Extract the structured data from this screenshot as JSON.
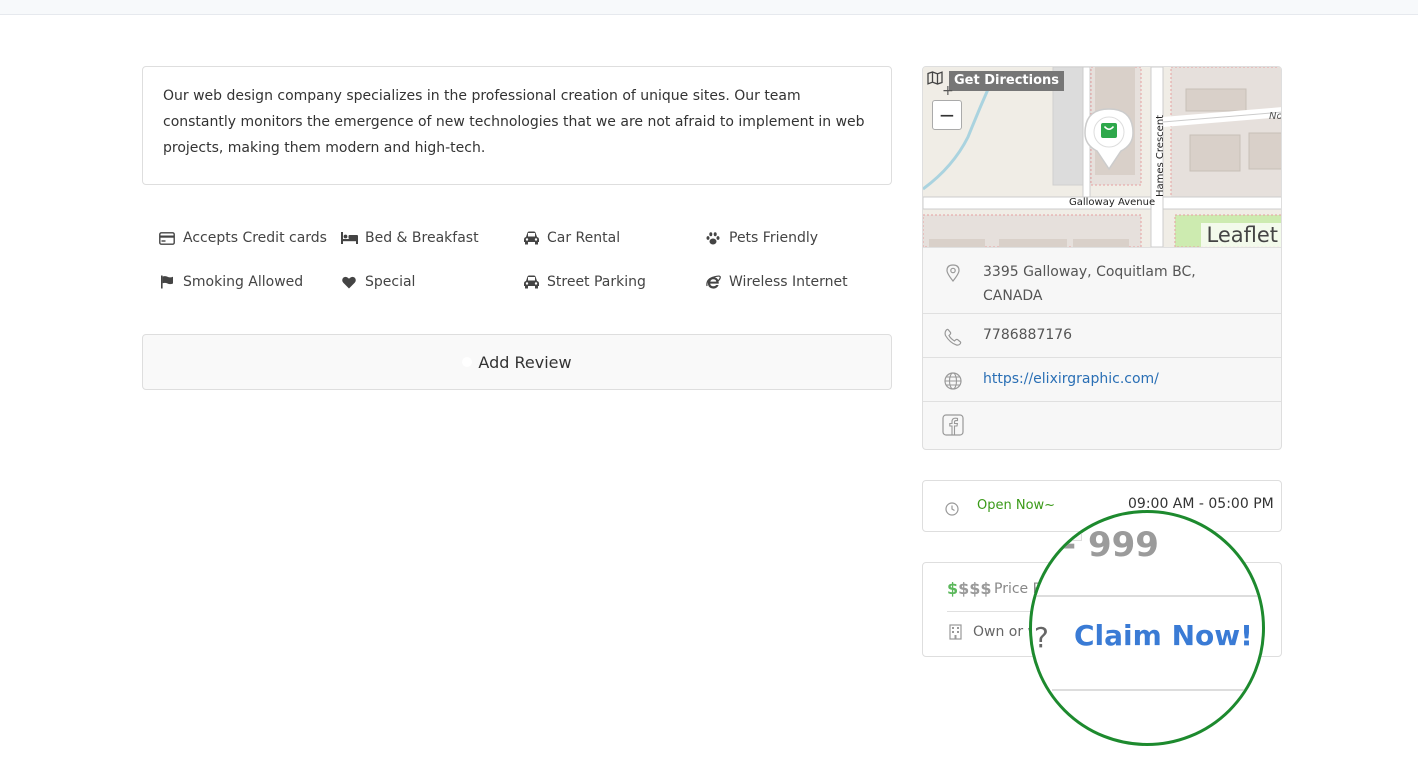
{
  "description": "Our web design company specializes in the professional creation of unique sites. Our team constantly monitors the emergence of new technologies that we are not afraid to implement in web projects, making them modern and high-tech.",
  "amenities": [
    {
      "label": "Accepts Credit cards",
      "icon": "credit-card-icon"
    },
    {
      "label": "Bed & Breakfast",
      "icon": "bed-icon"
    },
    {
      "label": "Car Rental",
      "icon": "car-icon"
    },
    {
      "label": "Pets Friendly",
      "icon": "paw-icon"
    },
    {
      "label": "Smoking Allowed",
      "icon": "flag-icon"
    },
    {
      "label": "Special",
      "icon": "heart-icon"
    },
    {
      "label": "Street Parking",
      "icon": "car-icon"
    },
    {
      "label": "Wireless Internet",
      "icon": "internet-explorer-icon"
    }
  ],
  "add_review_label": "Add Review",
  "map": {
    "get_directions": "Get Directions",
    "zoom_out": "−",
    "zoom_in": "+",
    "attribution": "Leaflet",
    "street_labels": {
      "galloway": "Galloway Avenue",
      "hames": "Hames Crescent",
      "nor": "Nor"
    }
  },
  "contact": {
    "address": "3395 Galloway, Coquitlam BC, CANADA",
    "phone": "7786887176",
    "website": "https://elixirgraphic.com/"
  },
  "hours": {
    "status": "Open Now~",
    "time": "09:00 AM - 05:00 PM"
  },
  "price": {
    "symbol_active": "$",
    "symbol_inactive": "$$$",
    "label": "Price R",
    "own_text": "Own or w"
  },
  "magnifier": {
    "number": "- 999",
    "question": "?",
    "claim": "Claim Now!"
  },
  "colors": {
    "accent_green": "#3a9a18",
    "link_blue": "#2a6fb5",
    "magnifier_ring": "#1d8a2e",
    "claim_blue": "#3a7bd5"
  }
}
